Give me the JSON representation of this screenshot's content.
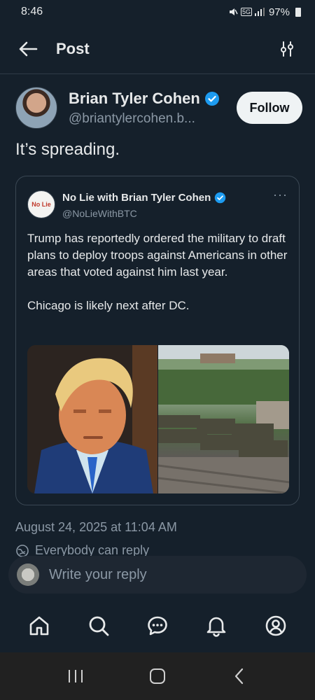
{
  "status_bar": {
    "time": "8:46",
    "network": "5G",
    "battery": "97%"
  },
  "header": {
    "title": "Post"
  },
  "post": {
    "author_name": "Brian Tyler Cohen",
    "author_handle": "@briantylercohen.b...",
    "follow_label": "Follow",
    "text": "It’s spreading.",
    "date": "August 24, 2025 at 11:04 AM",
    "reply_permission": "Everybody can reply"
  },
  "quote": {
    "avatar_text": "No Lie",
    "author_name": "No Lie with Brian Tyler Cohen",
    "author_handle": "@NoLieWithBTC",
    "more": "···",
    "body": "Trump has reportedly ordered the military to draft plans to deploy troops against Americans in other areas that voted against him last year.\n\nChicago is likely next after DC."
  },
  "reply": {
    "placeholder": "Write your reply"
  },
  "nav": {
    "icons": [
      "home-icon",
      "search-icon",
      "messages-icon",
      "notifications-icon",
      "profile-icon"
    ]
  },
  "colors": {
    "background": "#15202b",
    "accent": "#1d9bf0",
    "muted": "#8b98a5",
    "border": "#2f3b47"
  }
}
